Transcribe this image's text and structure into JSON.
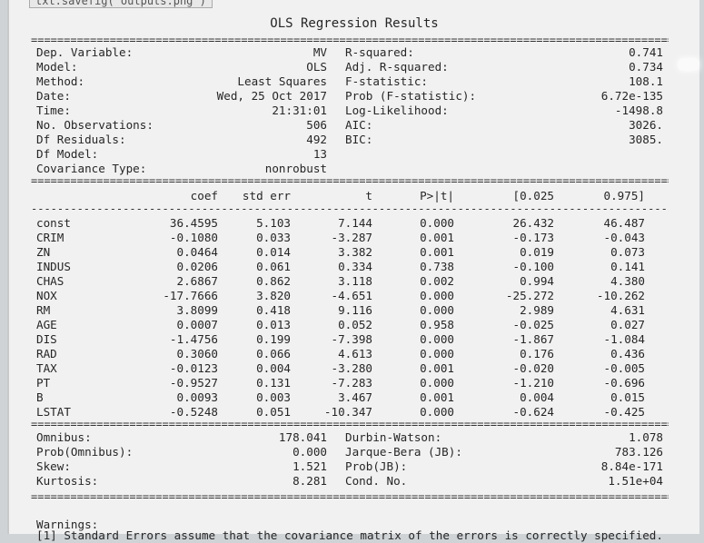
{
  "code_fragment": "txt.savefig('outputs.png')",
  "title": "OLS Regression Results",
  "summary_left": [
    {
      "label": "Dep. Variable:",
      "value": "MV"
    },
    {
      "label": "Model:",
      "value": "OLS"
    },
    {
      "label": "Method:",
      "value": "Least Squares"
    },
    {
      "label": "Date:",
      "value": "Wed, 25 Oct 2017"
    },
    {
      "label": "Time:",
      "value": "21:31:01"
    },
    {
      "label": "No. Observations:",
      "value": "506"
    },
    {
      "label": "Df Residuals:",
      "value": "492"
    },
    {
      "label": "Df Model:",
      "value": "13"
    },
    {
      "label": "Covariance Type:",
      "value": "nonrobust"
    }
  ],
  "summary_right": [
    {
      "label": "R-squared:",
      "value": "0.741"
    },
    {
      "label": "Adj. R-squared:",
      "value": "0.734"
    },
    {
      "label": "F-statistic:",
      "value": "108.1"
    },
    {
      "label": "Prob (F-statistic):",
      "value": "6.72e-135"
    },
    {
      "label": "Log-Likelihood:",
      "value": "-1498.8"
    },
    {
      "label": "AIC:",
      "value": "3026."
    },
    {
      "label": "BIC:",
      "value": "3085."
    }
  ],
  "coef_headers": [
    "coef",
    "std err",
    "t",
    "P>|t|",
    "[0.025",
    "0.975]"
  ],
  "coef_rows": [
    [
      "const",
      "36.4595",
      "5.103",
      "7.144",
      "0.000",
      "26.432",
      "46.487"
    ],
    [
      "CRIM",
      "-0.1080",
      "0.033",
      "-3.287",
      "0.001",
      "-0.173",
      "-0.043"
    ],
    [
      "ZN",
      "0.0464",
      "0.014",
      "3.382",
      "0.001",
      "0.019",
      "0.073"
    ],
    [
      "INDUS",
      "0.0206",
      "0.061",
      "0.334",
      "0.738",
      "-0.100",
      "0.141"
    ],
    [
      "CHAS",
      "2.6867",
      "0.862",
      "3.118",
      "0.002",
      "0.994",
      "4.380"
    ],
    [
      "NOX",
      "-17.7666",
      "3.820",
      "-4.651",
      "0.000",
      "-25.272",
      "-10.262"
    ],
    [
      "RM",
      "3.8099",
      "0.418",
      "9.116",
      "0.000",
      "2.989",
      "4.631"
    ],
    [
      "AGE",
      "0.0007",
      "0.013",
      "0.052",
      "0.958",
      "-0.025",
      "0.027"
    ],
    [
      "DIS",
      "-1.4756",
      "0.199",
      "-7.398",
      "0.000",
      "-1.867",
      "-1.084"
    ],
    [
      "RAD",
      "0.3060",
      "0.066",
      "4.613",
      "0.000",
      "0.176",
      "0.436"
    ],
    [
      "TAX",
      "-0.0123",
      "0.004",
      "-3.280",
      "0.001",
      "-0.020",
      "-0.005"
    ],
    [
      "PT",
      "-0.9527",
      "0.131",
      "-7.283",
      "0.000",
      "-1.210",
      "-0.696"
    ],
    [
      "B",
      "0.0093",
      "0.003",
      "3.467",
      "0.001",
      "0.004",
      "0.015"
    ],
    [
      "LSTAT",
      "-0.5248",
      "0.051",
      "-10.347",
      "0.000",
      "-0.624",
      "-0.425"
    ]
  ],
  "diag_left": [
    {
      "label": "Omnibus:",
      "value": "178.041"
    },
    {
      "label": "Prob(Omnibus):",
      "value": "0.000"
    },
    {
      "label": "Skew:",
      "value": "1.521"
    },
    {
      "label": "Kurtosis:",
      "value": "8.281"
    }
  ],
  "diag_right": [
    {
      "label": "Durbin-Watson:",
      "value": "1.078"
    },
    {
      "label": "Jarque-Bera (JB):",
      "value": "783.126"
    },
    {
      "label": "Prob(JB):",
      "value": "8.84e-171"
    },
    {
      "label": "Cond. No.",
      "value": "1.51e+04"
    }
  ],
  "warnings_label": "Warnings:",
  "warning_text": "[1] Standard Errors assume that the covariance matrix of the errors is correctly specified."
}
